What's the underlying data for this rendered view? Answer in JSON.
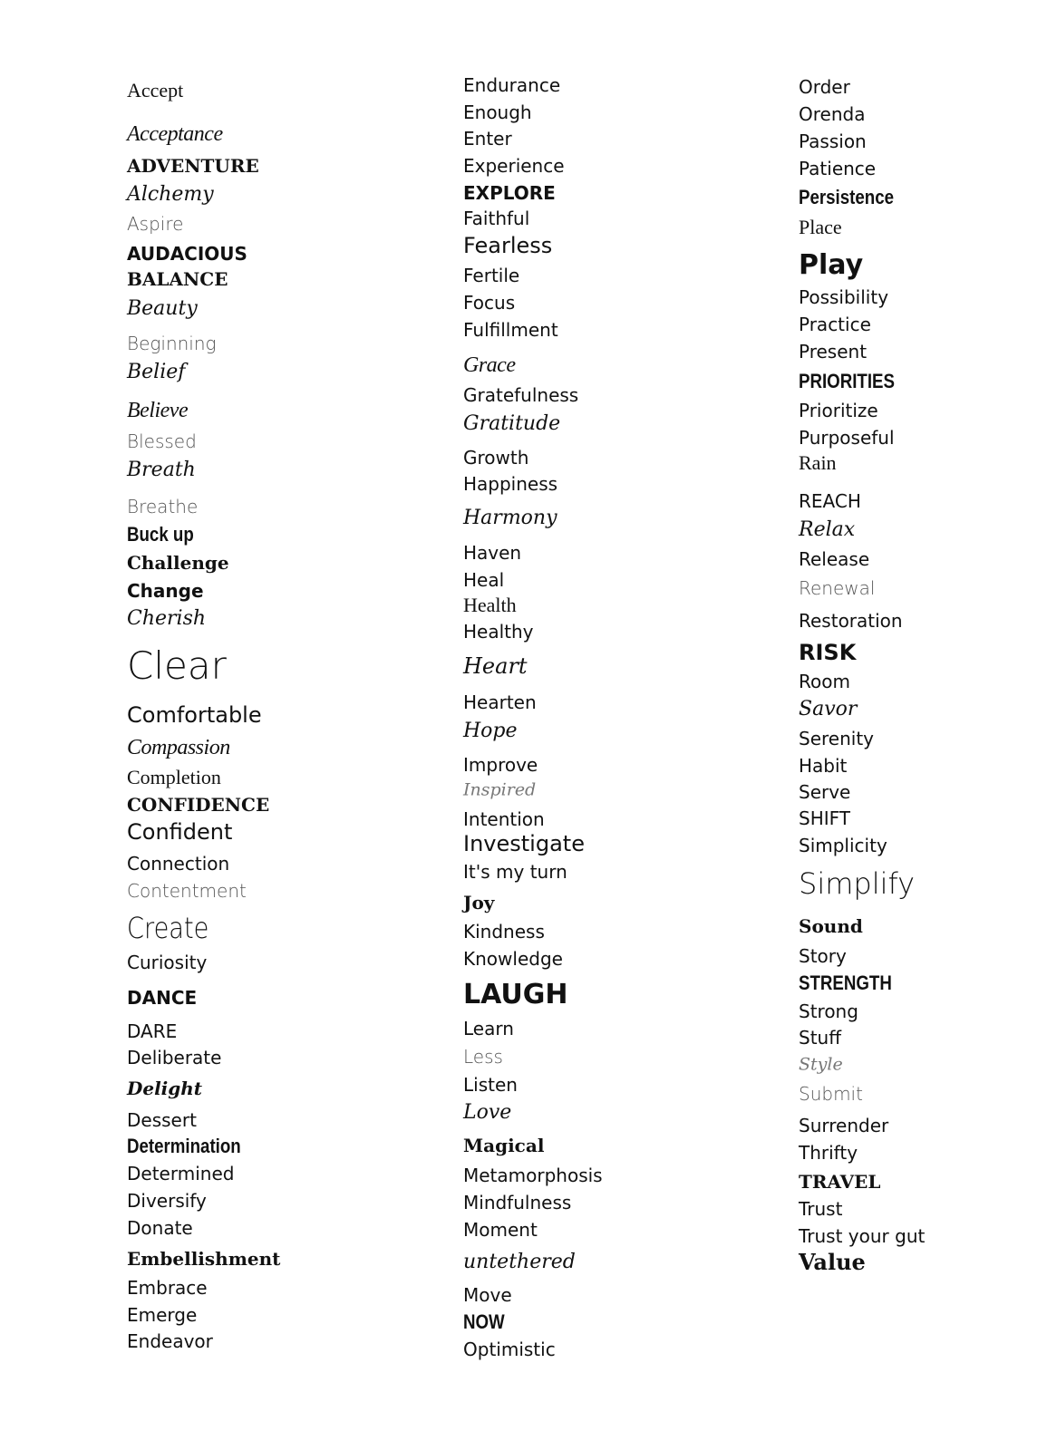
{
  "columns": [
    [
      "Accept",
      "Acceptance",
      "ADVENTURE",
      "Alchemy",
      "Aspire",
      "AUDACIOUS",
      "BALANCE",
      "Beauty",
      "Beginning",
      "Belief",
      "Believe",
      "Blessed",
      "Breath",
      "Breathe",
      "Buck up",
      "Challenge",
      "Change",
      "Cherish",
      "Clear",
      "Comfortable",
      "Compassion",
      "Completion",
      "CONFIDENCE",
      "Confident",
      "Connection",
      "Contentment",
      "Create",
      "Curiosity",
      "DANCE",
      "DARE",
      "Deliberate",
      "Delight",
      "Dessert",
      "Determination",
      "Determined",
      "Diversify",
      "Donate",
      "Embellishment",
      "Embrace",
      "Emerge",
      "Endeavor"
    ],
    [
      "Endurance",
      "Enough",
      "Enter",
      "Experience",
      "EXPLORE",
      "Faithful",
      "Fearless",
      "Fertile",
      "Focus",
      "Fulfillment",
      "Grace",
      "Gratefulness",
      "Gratitude",
      "Growth",
      "Happiness",
      "Harmony",
      "Haven",
      "Heal",
      "Health",
      "Healthy",
      "Heart",
      "Hearten",
      "Hope",
      "Improve",
      "Inspired",
      "Intention",
      "Investigate",
      "It's my turn",
      "Joy",
      "Kindness",
      "Knowledge",
      "LAUGH",
      "Learn",
      "Less",
      "Listen",
      "Love",
      "Magical",
      "Metamorphosis",
      "Mindfulness",
      "Moment",
      "untethered",
      "Move",
      "NOW",
      "Optimistic"
    ],
    [
      "Order",
      "Orenda",
      "Passion",
      "Patience",
      "Persistence",
      "Place",
      "Play",
      "Possibility",
      "Practice",
      "Present",
      "PRIORITIES",
      "Prioritize",
      "Purposeful",
      "Rain",
      "REACH",
      "Relax",
      "Release",
      "Renewal",
      "Restoration",
      "RISK",
      "Room",
      "Savor",
      "Serenity",
      "Habit",
      "Serve",
      "SHIFT",
      "Simplicity",
      "Simplify",
      "Sound",
      "Story",
      "STRENGTH",
      "Strong",
      "Stuff",
      "Style",
      "Submit",
      "Surrender",
      "Thrifty",
      "TRAVEL",
      "Trust",
      "Trust your gut",
      "Value"
    ]
  ]
}
